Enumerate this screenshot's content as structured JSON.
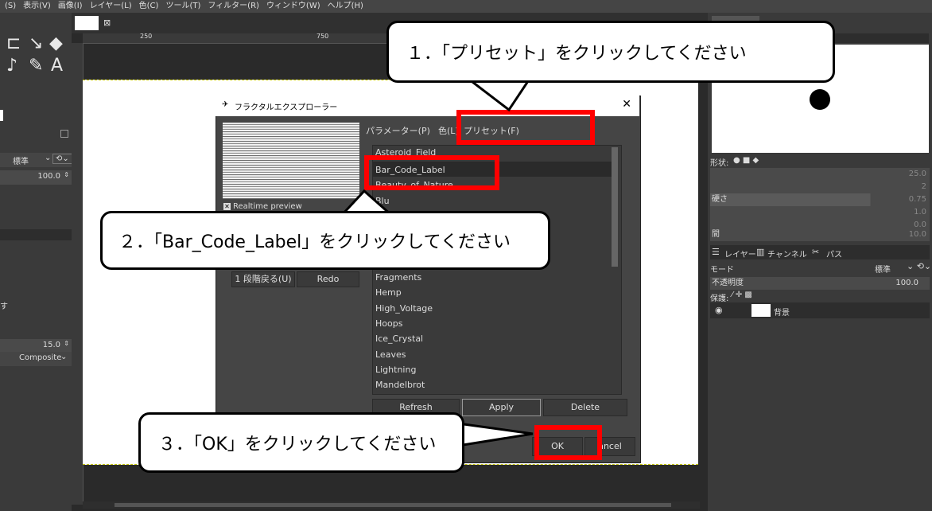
{
  "menubar": [
    "(S)",
    "表示(V)",
    "画像(I)",
    "レイヤー(L)",
    "色(C)",
    "ツール(T)",
    "フィルター(R)",
    "ウィンドウ(W)",
    "ヘルプ(H)"
  ],
  "toolbox": {
    "mode_value": "標準",
    "opacity_value": "100.0",
    "size_value": "15.0",
    "composite_value": "Composite",
    "partial_text": "す"
  },
  "ruler": {
    "mark_250": "250",
    "mark_750": "750"
  },
  "dock": {
    "shape_label": "形状:",
    "brush_rows": [
      {
        "label": "",
        "value": "25.0"
      },
      {
        "label": "",
        "value": "2"
      },
      {
        "label": "硬さ",
        "value": "0.75"
      },
      {
        "label": "",
        "value": "1.0"
      },
      {
        "label": "",
        "value": "0.0"
      },
      {
        "label": "間",
        "value": "10.0"
      }
    ],
    "tabs": {
      "layers": "レイヤー",
      "channels": "チャンネル",
      "paths": "パス"
    },
    "mode_label": "モード",
    "mode_value": "標準",
    "opacity_label": "不透明度",
    "opacity_value": "100.0",
    "lock_label": "保護:",
    "layer_name": "背景"
  },
  "dialog": {
    "title": "フラクタルエクスプローラー",
    "realtime_label": "Realtime preview",
    "tabs": {
      "params": "パラメーター(P)",
      "color": "色(L)",
      "presets": "プリセット(F)"
    },
    "presets": [
      "Asteroid_Field",
      "Bar_Code_Label",
      "Beauty_of_Nature",
      "Blu",
      "Fragments",
      "Hemp",
      "High_Voltage",
      "Hoops",
      "Ice_Crystal",
      "Leaves",
      "Lightning",
      "Mandelbrot"
    ],
    "undo_label": "1 段階戻る(U)",
    "redo_label": "Redo",
    "refresh_label": "Refresh",
    "apply_label": "Apply",
    "delete_label": "Delete",
    "ok_label": "OK",
    "cancel_label": "ancel"
  },
  "annotations": {
    "step1": "１．「プリセット」をクリックしてください",
    "step2": "２．「Bar_Code_Label」をクリックしてください",
    "step3": "３．「OK」をクリックしてください"
  },
  "colors": {
    "highlight": "#ff0000",
    "callout_bg": "#ffffff"
  }
}
